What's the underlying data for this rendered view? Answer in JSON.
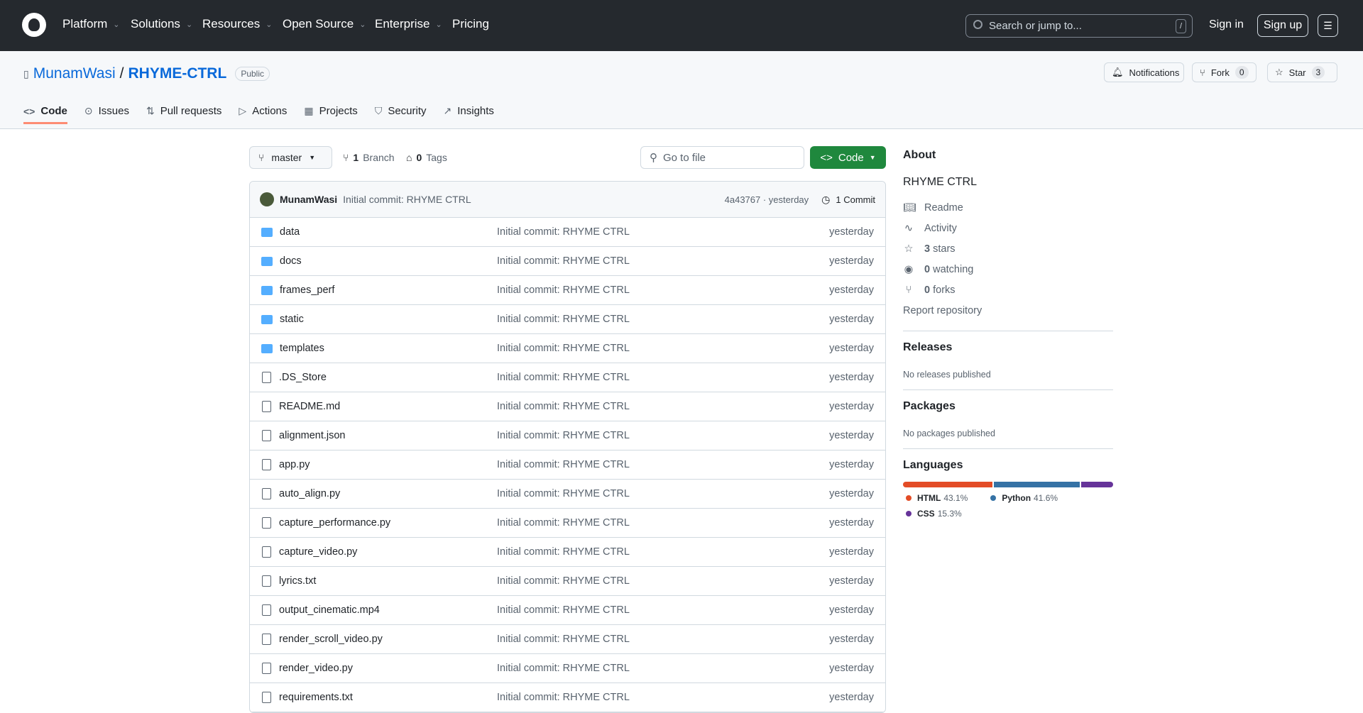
{
  "topnav": {
    "items": [
      "Platform",
      "Solutions",
      "Resources",
      "Open Source",
      "Enterprise",
      "Pricing"
    ],
    "search_placeholder": "Search or jump to...",
    "search_key": "/",
    "sign_in": "Sign in",
    "sign_up": "Sign up"
  },
  "repo": {
    "owner": "MunamWasi",
    "sep": "/",
    "name": "RHYME-CTRL",
    "visibility": "Public",
    "notifications": "Notifications",
    "fork": "Fork",
    "fork_count": "0",
    "star": "Star",
    "star_count": "3"
  },
  "tabs": [
    "Code",
    "Issues",
    "Pull requests",
    "Actions",
    "Projects",
    "Security",
    "Insights"
  ],
  "toolbar": {
    "branch": "master",
    "branches_count": "1",
    "branches_label": "Branch",
    "tags_count": "0",
    "tags_label": "Tags",
    "go_to_file": "Go to file",
    "code": "Code"
  },
  "commit": {
    "author": "MunamWasi",
    "message": "Initial commit: RHYME CTRL",
    "meta": "4a43767 · yesterday",
    "commits": "1 Commit"
  },
  "files": [
    {
      "name": "data",
      "type": "folder",
      "msg": "Initial commit: RHYME CTRL",
      "date": "yesterday"
    },
    {
      "name": "docs",
      "type": "folder",
      "msg": "Initial commit: RHYME CTRL",
      "date": "yesterday"
    },
    {
      "name": "frames_perf",
      "type": "folder",
      "msg": "Initial commit: RHYME CTRL",
      "date": "yesterday"
    },
    {
      "name": "static",
      "type": "folder",
      "msg": "Initial commit: RHYME CTRL",
      "date": "yesterday"
    },
    {
      "name": "templates",
      "type": "folder",
      "msg": "Initial commit: RHYME CTRL",
      "date": "yesterday"
    },
    {
      "name": ".DS_Store",
      "type": "file",
      "msg": "Initial commit: RHYME CTRL",
      "date": "yesterday"
    },
    {
      "name": "README.md",
      "type": "file",
      "msg": "Initial commit: RHYME CTRL",
      "date": "yesterday"
    },
    {
      "name": "alignment.json",
      "type": "file",
      "msg": "Initial commit: RHYME CTRL",
      "date": "yesterday"
    },
    {
      "name": "app.py",
      "type": "file",
      "msg": "Initial commit: RHYME CTRL",
      "date": "yesterday"
    },
    {
      "name": "auto_align.py",
      "type": "file",
      "msg": "Initial commit: RHYME CTRL",
      "date": "yesterday"
    },
    {
      "name": "capture_performance.py",
      "type": "file",
      "msg": "Initial commit: RHYME CTRL",
      "date": "yesterday"
    },
    {
      "name": "capture_video.py",
      "type": "file",
      "msg": "Initial commit: RHYME CTRL",
      "date": "yesterday"
    },
    {
      "name": "lyrics.txt",
      "type": "file",
      "msg": "Initial commit: RHYME CTRL",
      "date": "yesterday"
    },
    {
      "name": "output_cinematic.mp4",
      "type": "file",
      "msg": "Initial commit: RHYME CTRL",
      "date": "yesterday"
    },
    {
      "name": "render_scroll_video.py",
      "type": "file",
      "msg": "Initial commit: RHYME CTRL",
      "date": "yesterday"
    },
    {
      "name": "render_video.py",
      "type": "file",
      "msg": "Initial commit: RHYME CTRL",
      "date": "yesterday"
    },
    {
      "name": "requirements.txt",
      "type": "file",
      "msg": "Initial commit: RHYME CTRL",
      "date": "yesterday"
    }
  ],
  "about": {
    "heading": "About",
    "description": "RHYME CTRL",
    "readme": "Readme",
    "activity": "Activity",
    "stars_count": "3",
    "stars_label": "stars",
    "watching_count": "0",
    "watching_label": "watching",
    "forks_count": "0",
    "forks_label": "forks",
    "report": "Report repository"
  },
  "releases": {
    "heading": "Releases",
    "empty": "No releases published"
  },
  "packages": {
    "heading": "Packages",
    "empty": "No packages published"
  },
  "languages": {
    "heading": "Languages",
    "items": [
      {
        "name": "HTML",
        "pct": "43.1%",
        "value": 43.1,
        "color": "#e34c26"
      },
      {
        "name": "Python",
        "pct": "41.6%",
        "value": 41.6,
        "color": "#3572a5"
      },
      {
        "name": "CSS",
        "pct": "15.3%",
        "value": 15.3,
        "color": "#663399"
      }
    ]
  }
}
